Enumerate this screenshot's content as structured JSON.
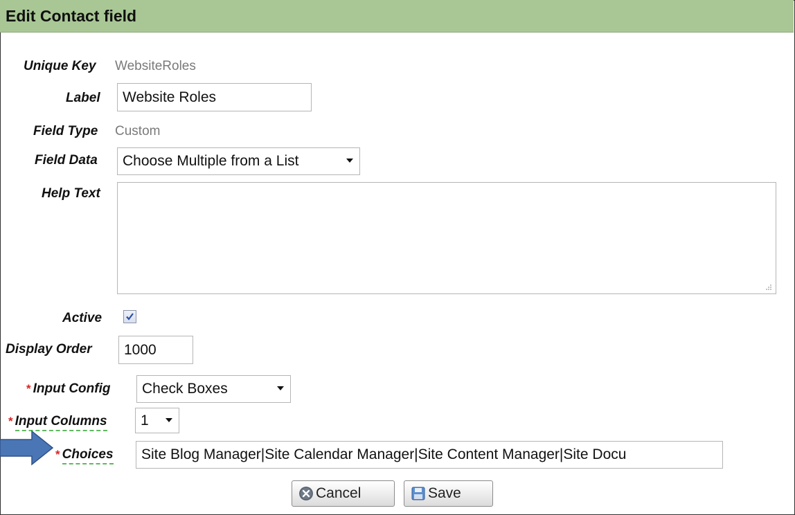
{
  "header": {
    "title": "Edit Contact field"
  },
  "fields": {
    "unique_key": {
      "label": "Unique Key",
      "value": "WebsiteRoles"
    },
    "label": {
      "label": "Label",
      "value": "Website Roles"
    },
    "field_type": {
      "label": "Field Type",
      "value": "Custom"
    },
    "field_data": {
      "label": "Field Data",
      "value": "Choose Multiple from a List"
    },
    "help_text": {
      "label": "Help Text",
      "value": ""
    },
    "active": {
      "label": "Active",
      "checked": true
    },
    "display_order": {
      "label": "Display Order",
      "value": "1000"
    },
    "input_config": {
      "label": "Input Config",
      "value": "Check Boxes",
      "required_mark": "*"
    },
    "input_columns": {
      "label": "Input Columns",
      "value": "1",
      "required_mark": "*"
    },
    "choices": {
      "label": "Choices",
      "value": "Site Blog Manager|Site Calendar Manager|Site Content Manager|Site Docu",
      "required_mark": "*"
    }
  },
  "buttons": {
    "cancel": "Cancel",
    "save": "Save"
  },
  "icons": {
    "dropdown": "chevron-down-icon",
    "cancel": "cancel-x-icon",
    "save": "floppy-disk-icon",
    "annotation": "arrow-right-icon",
    "resize": "resize-grip-icon",
    "check": "checkmark-icon"
  },
  "colors": {
    "header_bg": "#a9c795",
    "required": "#dd2222",
    "arrow": "#4a76b5",
    "field_value_muted": "#7a7a7a"
  }
}
